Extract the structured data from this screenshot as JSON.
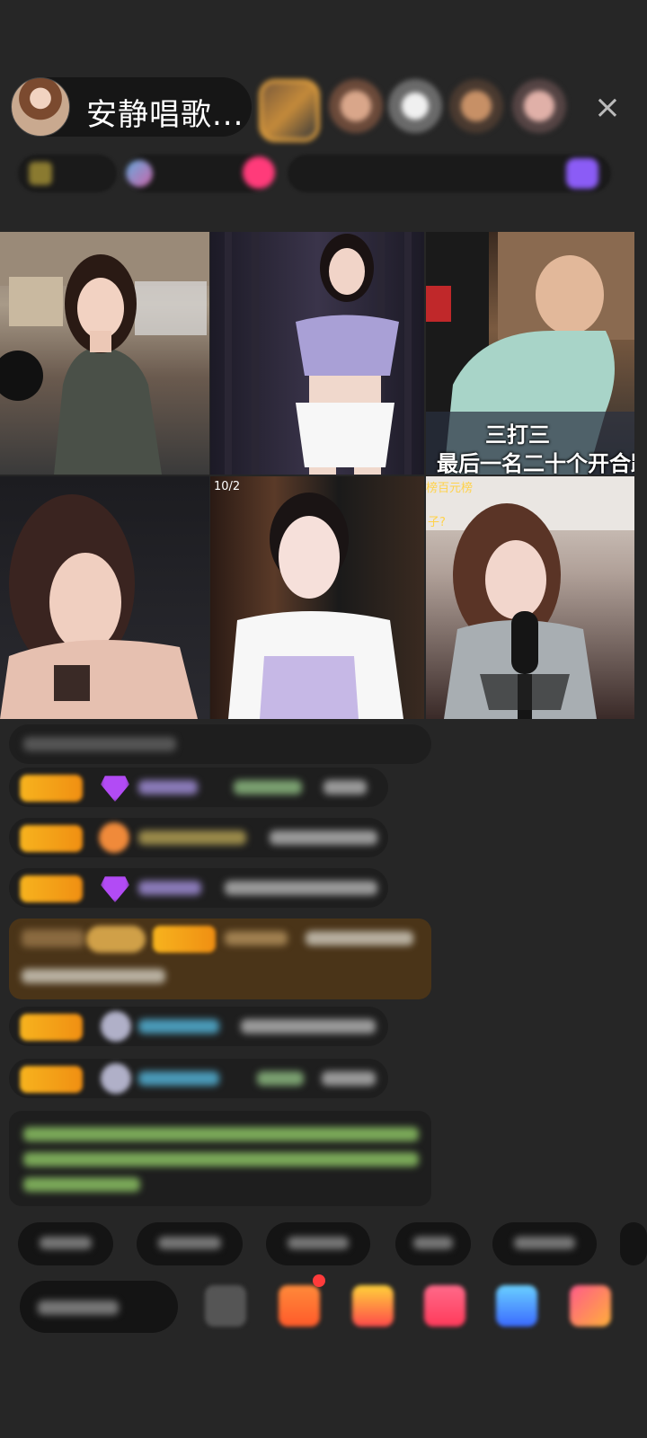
{
  "host": {
    "name": "安静唱歌..."
  },
  "header": {
    "viewer_count": "",
    "close_icon": "×",
    "subbar_chips": [
      "",
      "",
      "",
      "",
      ""
    ]
  },
  "grid": {
    "cells": [
      {
        "id": "1",
        "caption": "",
        "tag": ""
      },
      {
        "id": "2",
        "caption": "",
        "tag": ""
      },
      {
        "id": "3",
        "caption_line1": "三打三",
        "caption_line2": "最后一名二十个开合跳"
      },
      {
        "id": "4",
        "caption": ""
      },
      {
        "id": "5",
        "tag": "10/2"
      },
      {
        "id": "6",
        "tag": "榜百元榜",
        "tag2": "子?"
      }
    ]
  },
  "chat": {
    "messages": [
      {
        "text": ""
      },
      {
        "text": ""
      },
      {
        "text": ""
      },
      {
        "text": ""
      },
      {
        "text": ""
      },
      {
        "text": ""
      },
      {
        "text": ""
      },
      {
        "text": ""
      }
    ]
  },
  "bottom": {
    "quick_replies": [
      "",
      "",
      "",
      "",
      ""
    ],
    "say_placeholder": "",
    "gift_icons": [
      "box-icon",
      "gift-icon",
      "red-gift-icon",
      "blue-gift-icon",
      "grid-gift-icon",
      "more-icon"
    ]
  },
  "colors": {
    "background": "#262626",
    "badge": "#f5a623",
    "chat_green": "#9fd36a",
    "system_brown": "#5a3a14"
  }
}
